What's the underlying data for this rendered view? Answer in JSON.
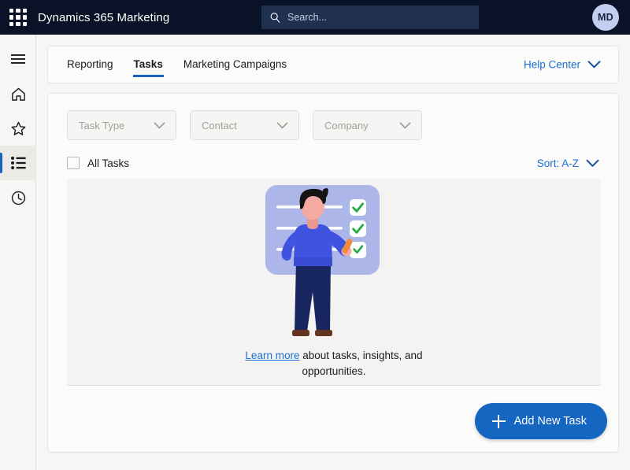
{
  "topbar": {
    "waffle_icon": "app-launcher-icon",
    "app_title": "Dynamics 365 Marketing",
    "search": {
      "icon": "search-icon",
      "placeholder": "Search..."
    },
    "avatar": {
      "initials": "MD"
    },
    "bg_color": "#0a1228",
    "search_bg_color": "#20304f",
    "avatar_bg_color": "#c3cdf2"
  },
  "sidebar": {
    "items": [
      {
        "icon": "hamburger-menu-icon",
        "name": "menu",
        "active": false
      },
      {
        "icon": "home-icon",
        "name": "home",
        "active": false
      },
      {
        "icon": "star-icon",
        "name": "favorites",
        "active": false
      },
      {
        "icon": "list-icon",
        "name": "tasks",
        "active": true
      },
      {
        "icon": "clock-icon",
        "name": "recent",
        "active": false
      }
    ],
    "active_indicator_color": "#1565c0"
  },
  "tabbar": {
    "tabs": [
      {
        "label": "Reporting",
        "active": false
      },
      {
        "label": "Tasks",
        "active": true
      },
      {
        "label": "Marketing Campaigns",
        "active": false
      }
    ],
    "help_center": {
      "label": "Help Center",
      "icon": "chevron-down-icon"
    },
    "active_underline_color": "#1565c0",
    "link_color": "#1a6fd4"
  },
  "filters": [
    {
      "label": "Task Type",
      "icon": "chevron-down-icon"
    },
    {
      "label": "Contact",
      "icon": "chevron-down-icon"
    },
    {
      "label": "Company",
      "icon": "chevron-down-icon"
    }
  ],
  "list_header": {
    "checkbox": {
      "label": "All Tasks",
      "checked": false
    },
    "sort": {
      "label": "Sort: A-Z",
      "icon": "chevron-down-icon"
    }
  },
  "empty_state": {
    "illustration": {
      "name": "task-checklist-illustration",
      "card_color": "#adb6e8",
      "check_color": "#22aa44",
      "sweater_color": "#3f52e0",
      "pants_color": "#17265e",
      "skin_color": "#f4aaa0",
      "hair_color": "#141414",
      "shoe_color": "#63341e",
      "pen_color": "#f08a3c",
      "checkbox_states": [
        "checked",
        "checked",
        "in-progress"
      ]
    },
    "caption_link": "Learn more",
    "caption_text": " about tasks, insights, and opportunities."
  },
  "add_button": {
    "label": "Add New Task",
    "icon": "plus-icon",
    "color": "#1466c0"
  }
}
